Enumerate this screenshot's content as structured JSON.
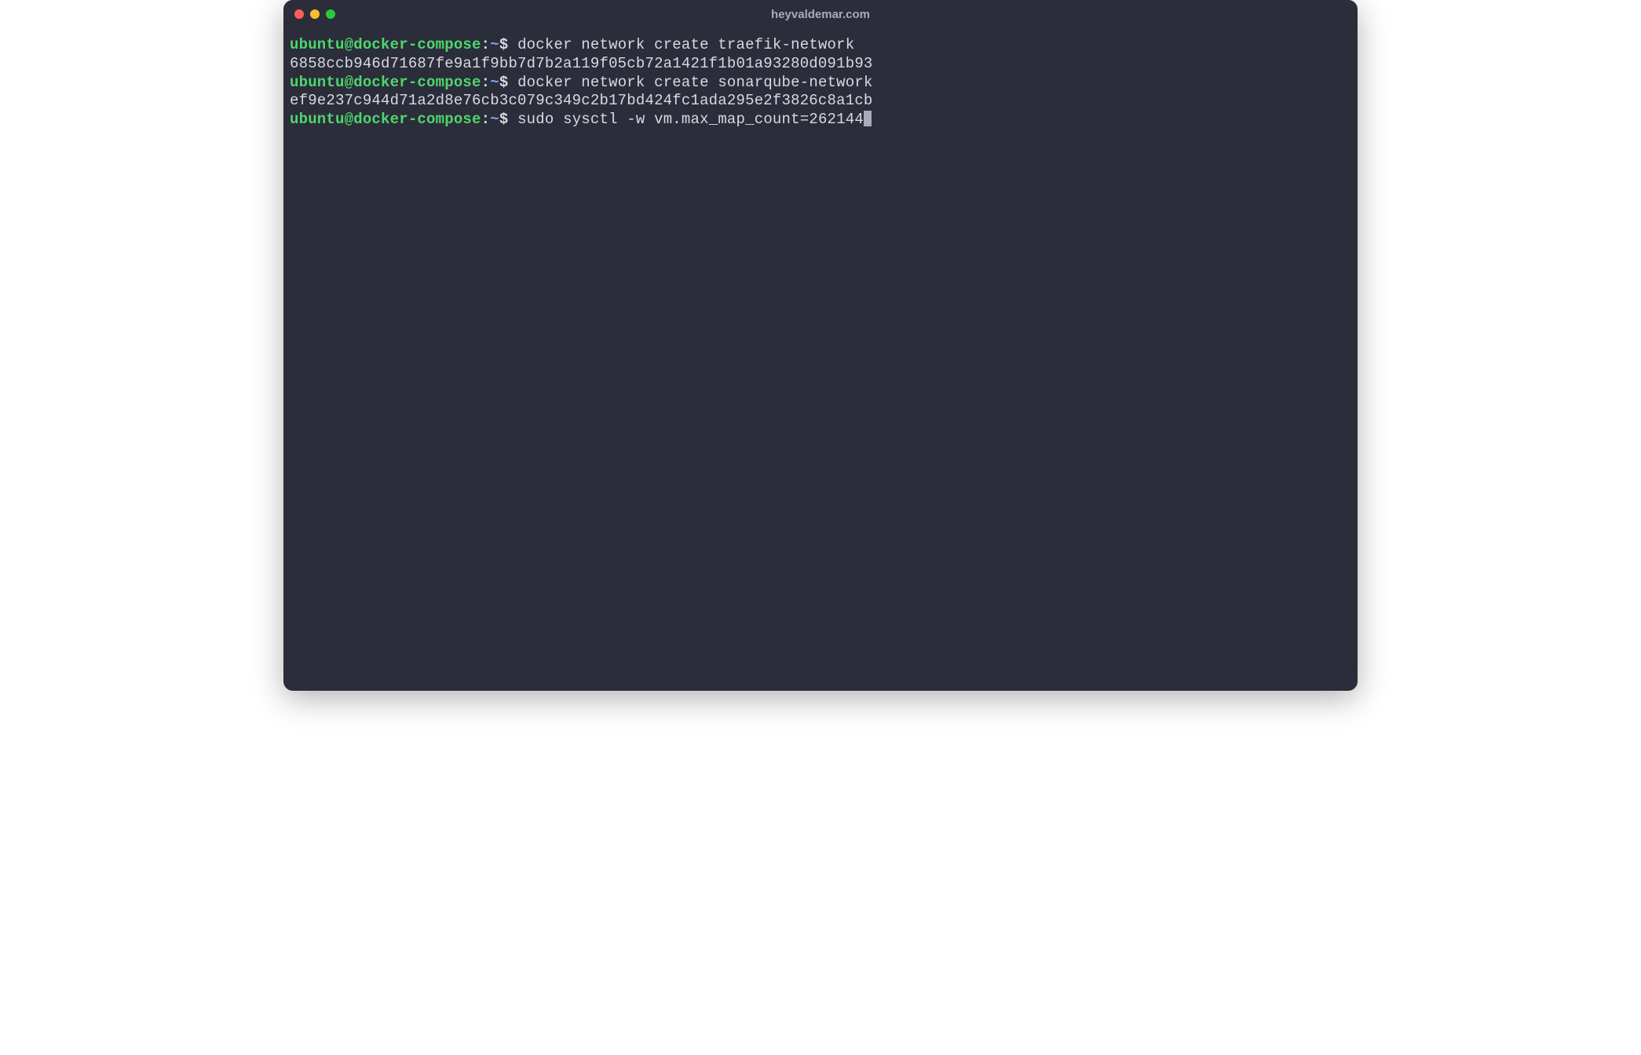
{
  "window": {
    "title": "heyvaldemar.com"
  },
  "prompt": {
    "user_host": "ubuntu@docker-compose",
    "cwd": "~",
    "symbol": "$"
  },
  "lines": {
    "cmd1": "docker network create traefik-network",
    "out1": "6858ccb946d71687fe9a1f9bb7d7b2a119f05cb72a1421f1b01a93280d091b93",
    "cmd2": "docker network create sonarqube-network",
    "out2": "ef9e237c944d71a2d8e76cb3c079c349c2b17bd424fc1ada295e2f3826c8a1cb",
    "cmd3": "sudo sysctl -w vm.max_map_count=262144"
  }
}
